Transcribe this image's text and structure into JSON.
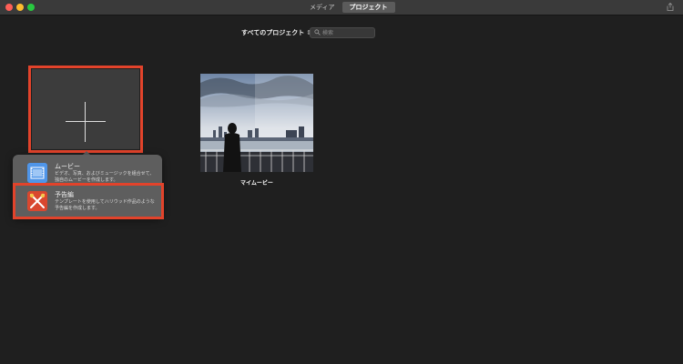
{
  "titlebar": {
    "tabs": [
      {
        "label": "メディア",
        "active": false
      },
      {
        "label": "プロジェクト",
        "active": true
      }
    ]
  },
  "toolbar": {
    "project_filter": "すべてのプロジェクト",
    "search_placeholder": "検索"
  },
  "popup": {
    "items": [
      {
        "title": "ムービー",
        "description": "ビデオ、写真、およびミュージックを組合せて、独自のムービーを作成します。",
        "icon": "film-icon"
      },
      {
        "title": "予告編",
        "description": "テンプレートを使用してハリウッド作品のような予告編を作成します。",
        "icon": "trailer-icon"
      }
    ]
  },
  "projects": [
    {
      "name": "マイムービー"
    }
  ],
  "colors": {
    "background": "#1f1f1f",
    "highlight": "#e2432b",
    "popup": "#5e5e5e",
    "movie_icon": "#4f95e8",
    "trailer_icon": "#d9472f"
  }
}
